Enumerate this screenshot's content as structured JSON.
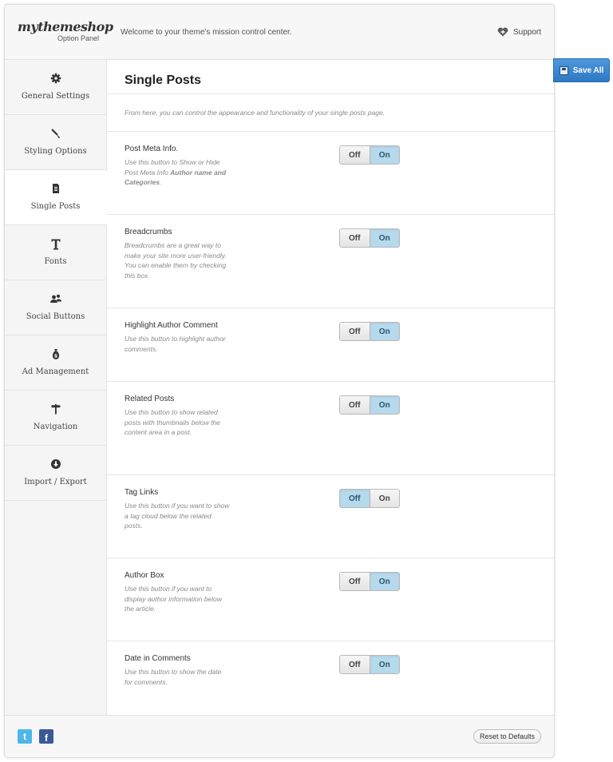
{
  "header": {
    "brand": "mythemeshop",
    "subtitle": "Option Panel",
    "welcome": "Welcome to your theme's mission control center.",
    "support_label": "Support"
  },
  "save_all_label": "Save All",
  "sidebar": {
    "items": [
      {
        "label": "General Settings",
        "icon": "gear-icon"
      },
      {
        "label": "Styling Options",
        "icon": "brush-icon"
      },
      {
        "label": "Single Posts",
        "icon": "document-icon",
        "active": true
      },
      {
        "label": "Fonts",
        "icon": "text-icon"
      },
      {
        "label": "Social Buttons",
        "icon": "users-icon"
      },
      {
        "label": "Ad Management",
        "icon": "money-bag-icon"
      },
      {
        "label": "Navigation",
        "icon": "signpost-icon"
      },
      {
        "label": "Import / Export",
        "icon": "download-icon"
      }
    ]
  },
  "main": {
    "title": "Single Posts",
    "intro": "From here, you can control the appearance and functionality of your single posts page.",
    "options": [
      {
        "title": "Post Meta Info.",
        "desc_pre": "Use this button to Show or Hide Post Meta Info ",
        "desc_bold": "Author name and Categories",
        "desc_post": ".",
        "value": "On"
      },
      {
        "title": "Breadcrumbs",
        "desc_pre": "Breadcrumbs are a great way to make your site more user-friendly. You can enable them by checking this box.",
        "desc_bold": "",
        "desc_post": "",
        "value": "On"
      },
      {
        "title": "Highlight Author Comment",
        "desc_pre": "Use this button to highlight author comments.",
        "desc_bold": "",
        "desc_post": "",
        "value": "On"
      },
      {
        "title": "Related Posts",
        "desc_pre": "Use this button to show related posts with thumbnails below the content area in a post.",
        "desc_bold": "",
        "desc_post": "",
        "value": "On"
      },
      {
        "title": "Tag Links",
        "desc_pre": "Use this button if you want to show a tag cloud below the related posts.",
        "desc_bold": "",
        "desc_post": "",
        "value": "Off"
      },
      {
        "title": "Author Box",
        "desc_pre": "Use this button if you want to display author information below the article.",
        "desc_bold": "",
        "desc_post": "",
        "value": "On"
      },
      {
        "title": "Date in Comments",
        "desc_pre": "Use this button to show the date for comments.",
        "desc_bold": "",
        "desc_post": "",
        "value": "On"
      }
    ],
    "toggle_labels": {
      "off": "Off",
      "on": "On"
    }
  },
  "footer": {
    "twitter_glyph": "t",
    "facebook_glyph": "f",
    "reset_label": "Reset to Defaults"
  },
  "colors": {
    "accent": "#2f78c3",
    "toggle_selected": "#b7d9ec",
    "twitter": "#4db8e8",
    "facebook": "#3b5998"
  }
}
